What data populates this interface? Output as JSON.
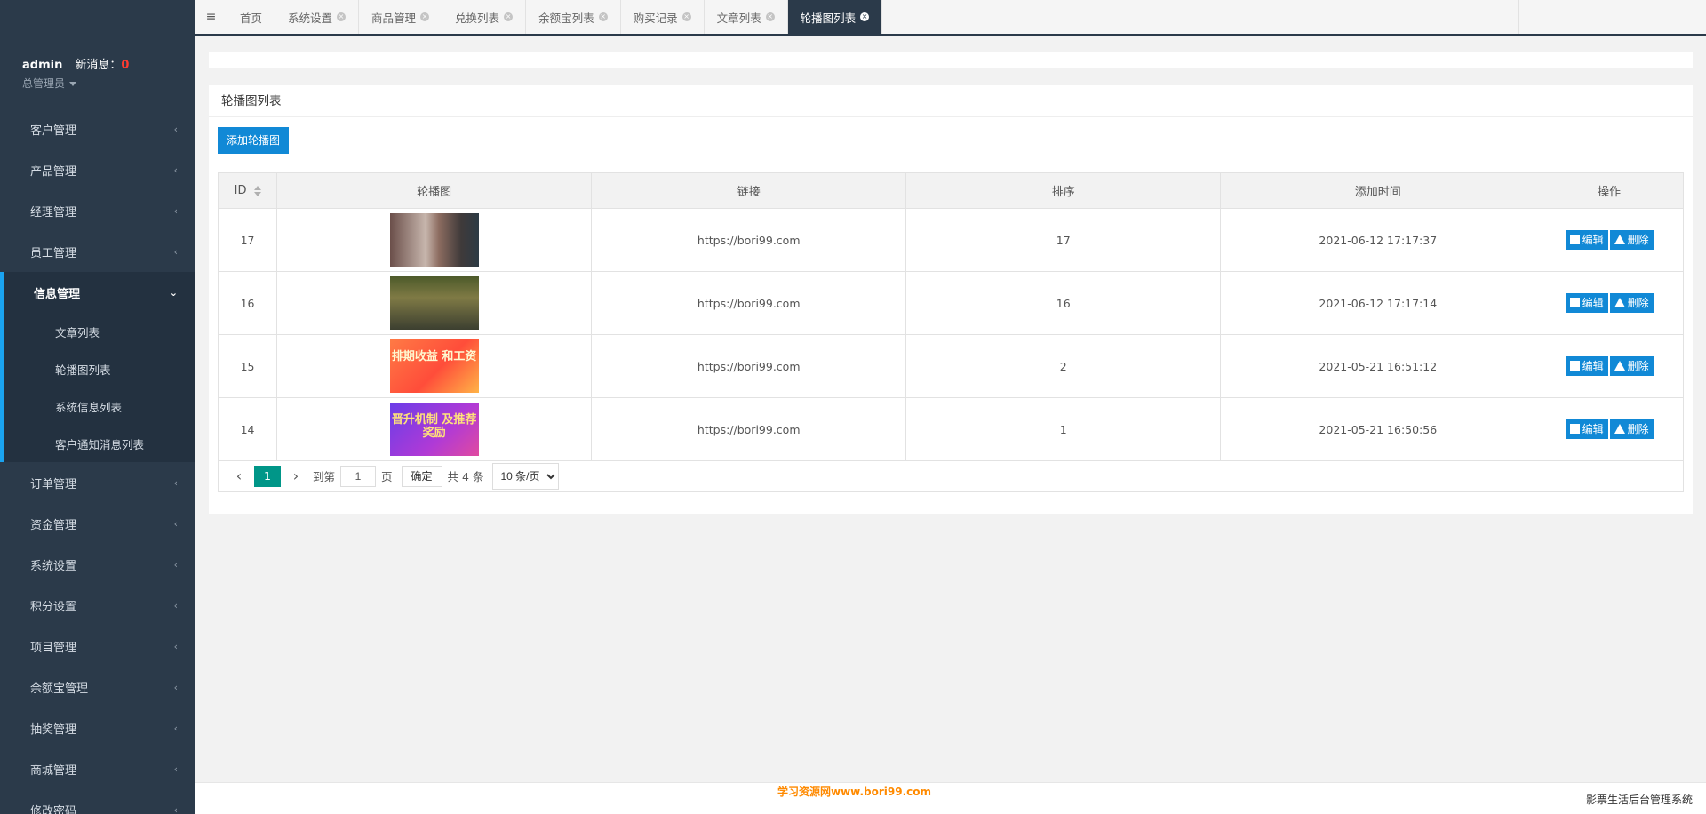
{
  "user": {
    "name": "admin",
    "msg_label": "新消息：",
    "msg_count": "0",
    "role": "总管理员"
  },
  "sidebar": {
    "items_top": [
      {
        "label": "客户管理"
      },
      {
        "label": "产品管理"
      },
      {
        "label": "经理管理"
      },
      {
        "label": "员工管理"
      }
    ],
    "open_item": {
      "label": "信息管理"
    },
    "sub_items": [
      {
        "label": "文章列表"
      },
      {
        "label": "轮播图列表"
      },
      {
        "label": "系统信息列表"
      },
      {
        "label": "客户通知消息列表"
      }
    ],
    "items_bottom": [
      {
        "label": "订单管理"
      },
      {
        "label": "资金管理"
      },
      {
        "label": "系统设置"
      },
      {
        "label": "积分设置"
      },
      {
        "label": "项目管理"
      },
      {
        "label": "余额宝管理"
      },
      {
        "label": "抽奖管理"
      },
      {
        "label": "商城管理"
      },
      {
        "label": "修改密码"
      }
    ]
  },
  "tabs": [
    {
      "label": "首页"
    },
    {
      "label": "系统设置"
    },
    {
      "label": "商品管理"
    },
    {
      "label": "兑换列表"
    },
    {
      "label": "余额宝列表"
    },
    {
      "label": "购买记录"
    },
    {
      "label": "文章列表"
    },
    {
      "label": "轮播图列表"
    }
  ],
  "main": {
    "card_title": "轮播图列表",
    "add_button": "添加轮播图",
    "columns": [
      "ID",
      "轮播图",
      "链接",
      "排序",
      "添加时间",
      "操作"
    ],
    "rows": [
      {
        "id": "17",
        "thumb_text": "",
        "link": "https://bori99.com",
        "sort": "17",
        "time": "2021-06-12 17:17:37"
      },
      {
        "id": "16",
        "thumb_text": "",
        "link": "https://bori99.com",
        "sort": "16",
        "time": "2021-06-12 17:17:14"
      },
      {
        "id": "15",
        "thumb_text": "排期收益 和工资",
        "link": "https://bori99.com",
        "sort": "2",
        "time": "2021-05-21 16:51:12"
      },
      {
        "id": "14",
        "thumb_text": "晋升机制 及推荐奖励",
        "link": "https://bori99.com",
        "sort": "1",
        "time": "2021-05-21 16:50:56"
      }
    ],
    "edit_label": "编辑",
    "delete_label": "删除"
  },
  "pager": {
    "current": "1",
    "goto_label": "到第",
    "page_value": "1",
    "page_label": "页",
    "ok_label": "确定",
    "total_label": "共 4 条",
    "page_size": "10 条/页"
  },
  "footer": {
    "watermark": "学习资源网www.bori99.com",
    "system_name": "影票生活后台管理系统"
  }
}
